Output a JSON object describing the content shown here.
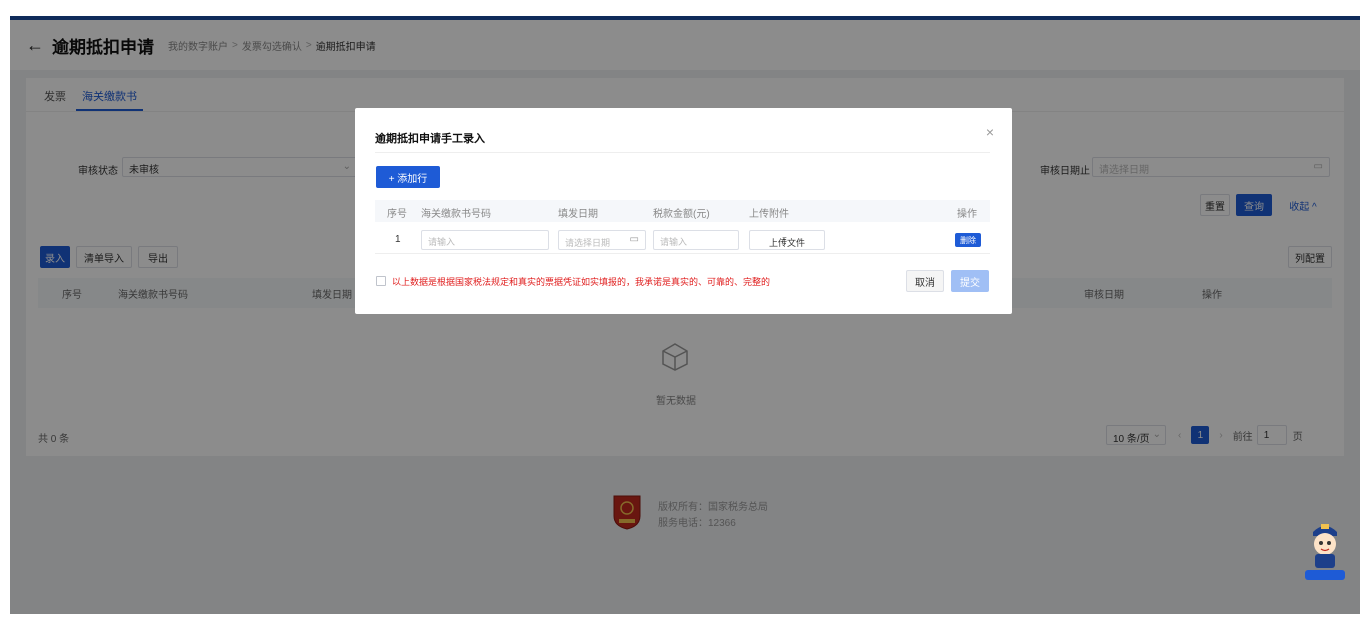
{
  "header": {
    "back_icon": "arrow-left-icon",
    "title": "逾期抵扣申请",
    "breadcrumb": [
      "我的数字账户",
      "发票勾选确认",
      "逾期抵扣申请"
    ]
  },
  "tabs": [
    {
      "label": "发票"
    },
    {
      "label": "海关缴款书",
      "active": true
    }
  ],
  "filters": {
    "audit_status_label": "审核状态",
    "audit_status_value": "未审核",
    "audit_date_label": "审核日期止",
    "audit_date_placeholder": "请选择日期"
  },
  "search_actions": {
    "reset": "重置",
    "query": "查询",
    "collapse": "收起 ^"
  },
  "toolbar": {
    "entry": "录入",
    "list_import": "清单导入",
    "export": "导出",
    "column_config": "列配置"
  },
  "table": {
    "columns": [
      "序号",
      "海关缴款书号码",
      "填发日期",
      "审核日期",
      "操作"
    ],
    "empty_text": "暂无数据"
  },
  "pagination": {
    "total": "共 0 条",
    "page_size": "10 条/页",
    "current_page": "1",
    "goto_label": "前往",
    "goto_value": "1",
    "page_suffix": "页"
  },
  "footer": {
    "copyright": "版权所有：国家税务总局",
    "hotline": "服务电话：12366"
  },
  "modal": {
    "title": "逾期抵扣申请手工录入",
    "add_row": "+ 添加行",
    "columns": [
      "序号",
      "海关缴款书号码",
      "填发日期",
      "税款金额(元)",
      "上传附件",
      "操作"
    ],
    "row": {
      "index": "1",
      "number_placeholder": "请输入",
      "date_placeholder": "请选择日期",
      "amount_placeholder": "请输入",
      "upload_label": "上传文件",
      "delete_label": "删除"
    },
    "agreement": "以上数据是根据国家税法规定和真实的票据凭证如实填报的，我承诺是真实的、可靠的、完整的",
    "cancel": "取消",
    "submit": "提交"
  }
}
